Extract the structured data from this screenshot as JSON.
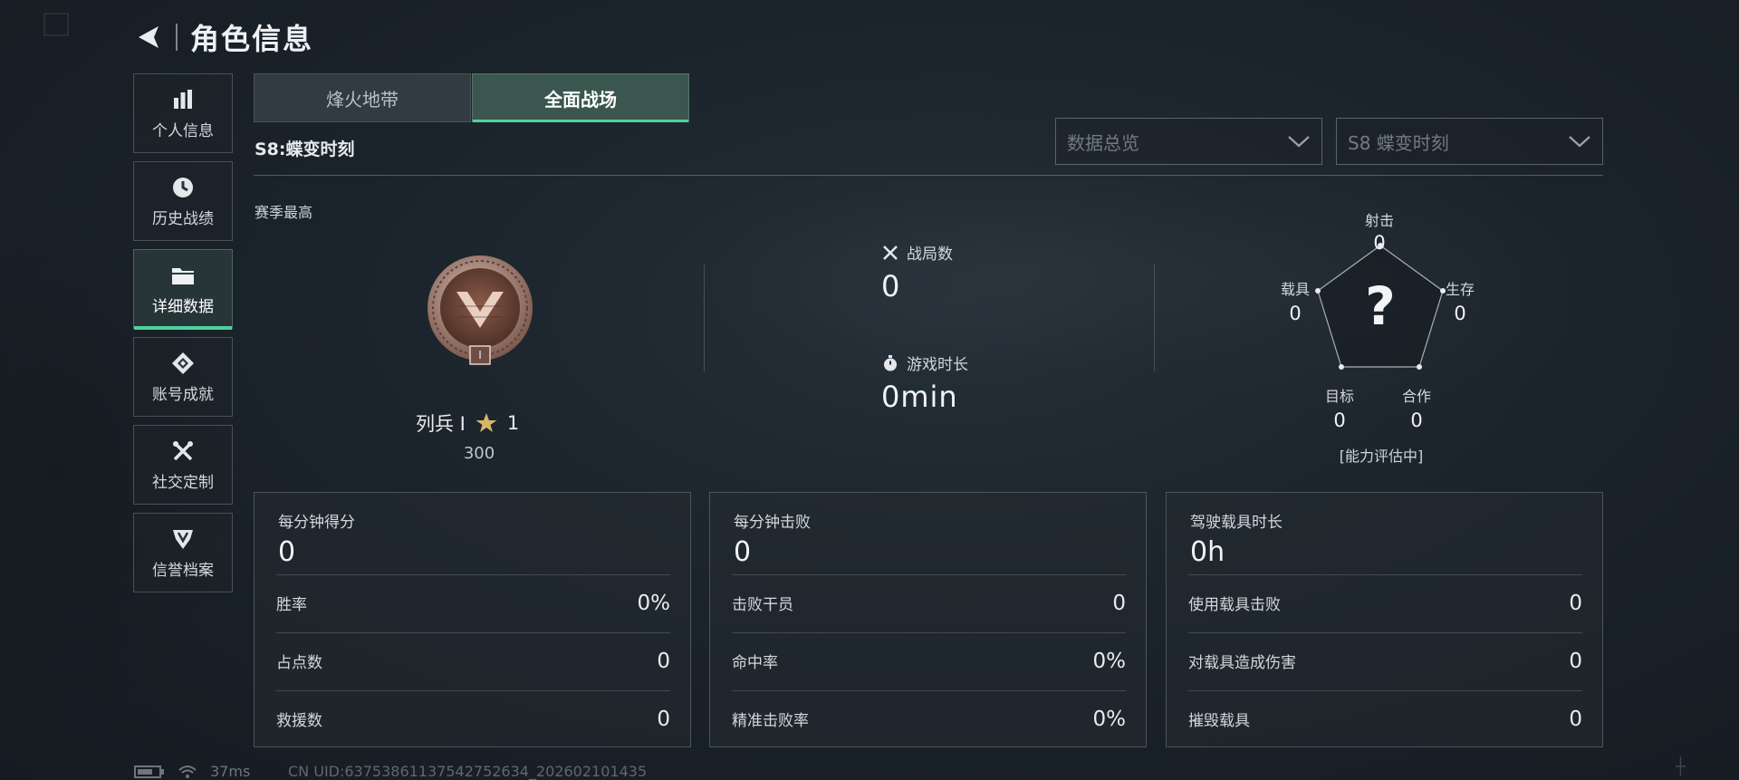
{
  "header": {
    "title": "角色信息"
  },
  "sidebar": {
    "items": [
      {
        "label": "个人信息",
        "icon": "bar-chart-icon"
      },
      {
        "label": "历史战绩",
        "icon": "clock-icon"
      },
      {
        "label": "详细数据",
        "icon": "folder-icon",
        "active": true
      },
      {
        "label": "账号成就",
        "icon": "medal-icon"
      },
      {
        "label": "社交定制",
        "icon": "tools-icon"
      },
      {
        "label": "信誉档案",
        "icon": "shield-icon"
      }
    ]
  },
  "mode_tabs": [
    {
      "label": "烽火地带"
    },
    {
      "label": "全面战场",
      "active": true
    }
  ],
  "season": {
    "title": "S8:蝶变时刻",
    "best_label": "赛季最高"
  },
  "dropdowns": {
    "scope": {
      "value": "数据总览"
    },
    "season": {
      "value": "S8 蝶变时刻"
    }
  },
  "rank": {
    "name": "列兵 Ⅰ",
    "stars": "1",
    "points": "300",
    "badge_numeral": "Ⅰ"
  },
  "summary": {
    "matches": {
      "label": "战局数",
      "value": "0"
    },
    "playtime": {
      "label": "游戏时长",
      "value": "0min"
    }
  },
  "radar": {
    "center": "?",
    "axes": [
      {
        "label": "射击",
        "value": "0"
      },
      {
        "label": "生存",
        "value": "0"
      },
      {
        "label": "合作",
        "value": "0"
      },
      {
        "label": "目标",
        "value": "0"
      },
      {
        "label": "载具",
        "value": "0"
      }
    ],
    "status": "[能力评估中]"
  },
  "panels": [
    {
      "title": "每分钟得分",
      "value": "0",
      "rows": [
        {
          "label": "胜率",
          "value": "0%"
        },
        {
          "label": "占点数",
          "value": "0"
        },
        {
          "label": "救援数",
          "value": "0"
        }
      ]
    },
    {
      "title": "每分钟击败",
      "value": "0",
      "rows": [
        {
          "label": "击败干员",
          "value": "0"
        },
        {
          "label": "命中率",
          "value": "0%"
        },
        {
          "label": "精准击败率",
          "value": "0%"
        }
      ]
    },
    {
      "title": "驾驶载具时长",
      "value": "0h",
      "rows": [
        {
          "label": "使用载具击败",
          "value": "0"
        },
        {
          "label": "对载具造成伤害",
          "value": "0"
        },
        {
          "label": "摧毁载具",
          "value": "0"
        }
      ]
    }
  ],
  "footer": {
    "ping": "37ms",
    "uid": "CN UID:63753861137542752634_202602101435",
    "corner": "┼"
  },
  "colors": {
    "accent": "#4fd1a0",
    "bg": "#1b232b"
  }
}
